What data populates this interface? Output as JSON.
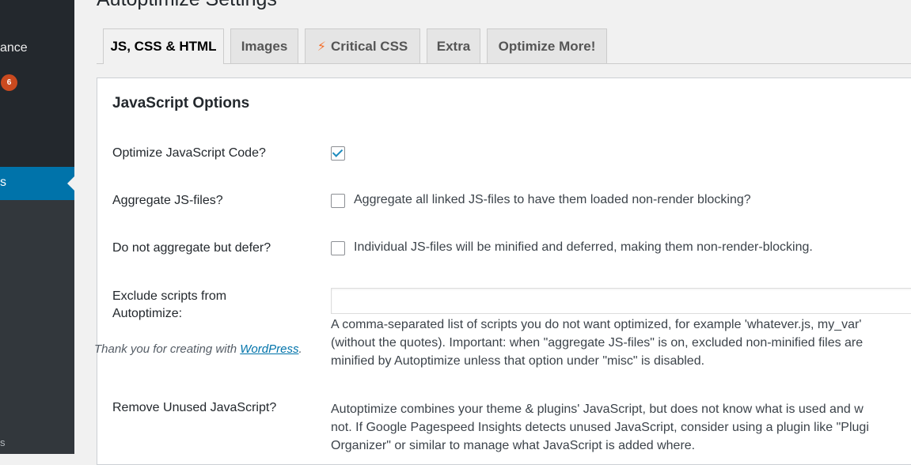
{
  "sidebar": {
    "appearance_fragment": "ance",
    "updates_badge": "6",
    "active_fragment": "s",
    "bottom_fragment": "s"
  },
  "page": {
    "title": "Autoptimize Settings"
  },
  "tabs": [
    {
      "label": "JS, CSS & HTML",
      "active": true
    },
    {
      "label": "Images",
      "active": false
    },
    {
      "label": "Critical CSS",
      "active": false,
      "icon": "lightning-bolt-icon"
    },
    {
      "label": "Extra",
      "active": false
    },
    {
      "label": "Optimize More!",
      "active": false
    }
  ],
  "js_options": {
    "section_title": "JavaScript Options",
    "optimize_js": {
      "label": "Optimize JavaScript Code?",
      "checked": true
    },
    "aggregate_js": {
      "label": "Aggregate JS-files?",
      "checked": false,
      "description": "Aggregate all linked JS-files to have them loaded non-render blocking?"
    },
    "defer_js": {
      "label": "Do not aggregate but defer?",
      "checked": false,
      "description": "Individual JS-files will be minified and deferred, making them non-render-blocking."
    },
    "exclude": {
      "label_line1": "Exclude scripts from",
      "label_line2": "Autoptimize:",
      "value": "",
      "desc_line1": "A comma-separated list of scripts you do not want optimized, for example 'whatever.js, my_var'",
      "desc_line2": "(without the quotes). Important: when \"aggregate JS-files\" is on, excluded non-minified files are",
      "desc_line3": "minified by Autoptimize unless that option under \"misc\" is disabled."
    },
    "unused_js": {
      "label": "Remove Unused JavaScript?",
      "desc_line1": "Autoptimize combines your theme & plugins' JavaScript, but does not know what is used and w",
      "desc_line2": "not. If Google Pagespeed Insights detects unused JavaScript, consider using a plugin like \"Plugi",
      "desc_line3": "Organizer\" or similar to manage what JavaScript is added where."
    }
  },
  "footer": {
    "thanks_prefix": "Thank you for creating with ",
    "wordpress_link": "WordPress",
    "thanks_suffix": "."
  },
  "colors": {
    "admin_menu_bg": "#23282d",
    "active_menu": "#0073aa",
    "badge": "#ca4a1f",
    "checkmark": "#1e8cbe",
    "bolt": "#f56e28"
  }
}
